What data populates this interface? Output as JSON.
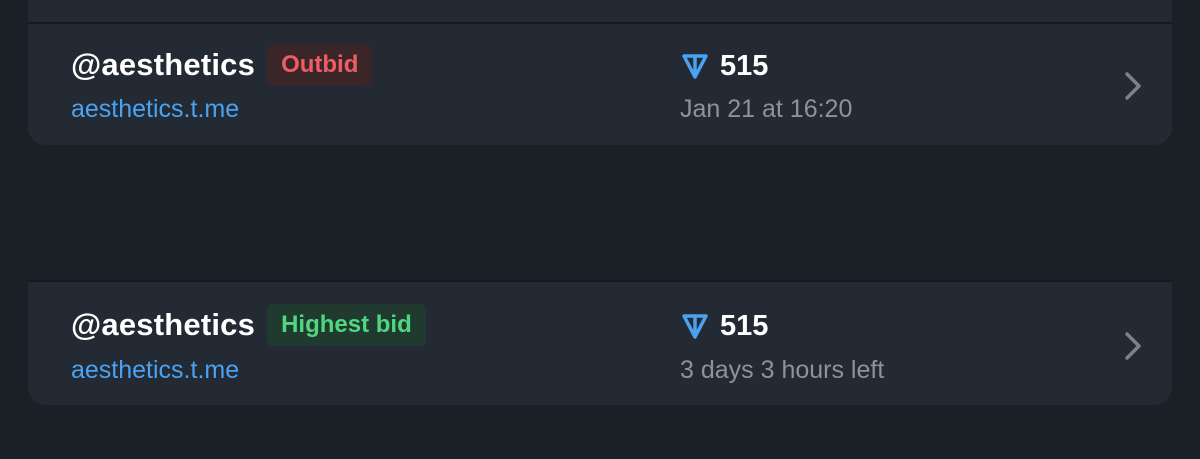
{
  "auctions": [
    {
      "username": "@aesthetics",
      "status": "Outbid",
      "link": "aesthetics.t.me",
      "price": "515",
      "detail": "Jan 21 at 16:20"
    },
    {
      "username": "@aesthetics",
      "status": "Highest bid",
      "link": "aesthetics.t.me",
      "price": "515",
      "detail": "3 days 3 hours left"
    }
  ],
  "colors": {
    "background": "#1b2027",
    "card": "#232a33",
    "link": "#4aa3f2",
    "outbid_text": "#ef5d62",
    "highest_bid_text": "#4ed77f",
    "ton_icon": "#4aa3f2"
  },
  "icons": {
    "currency": "ton-icon",
    "chevron": "chevron-right-icon"
  }
}
